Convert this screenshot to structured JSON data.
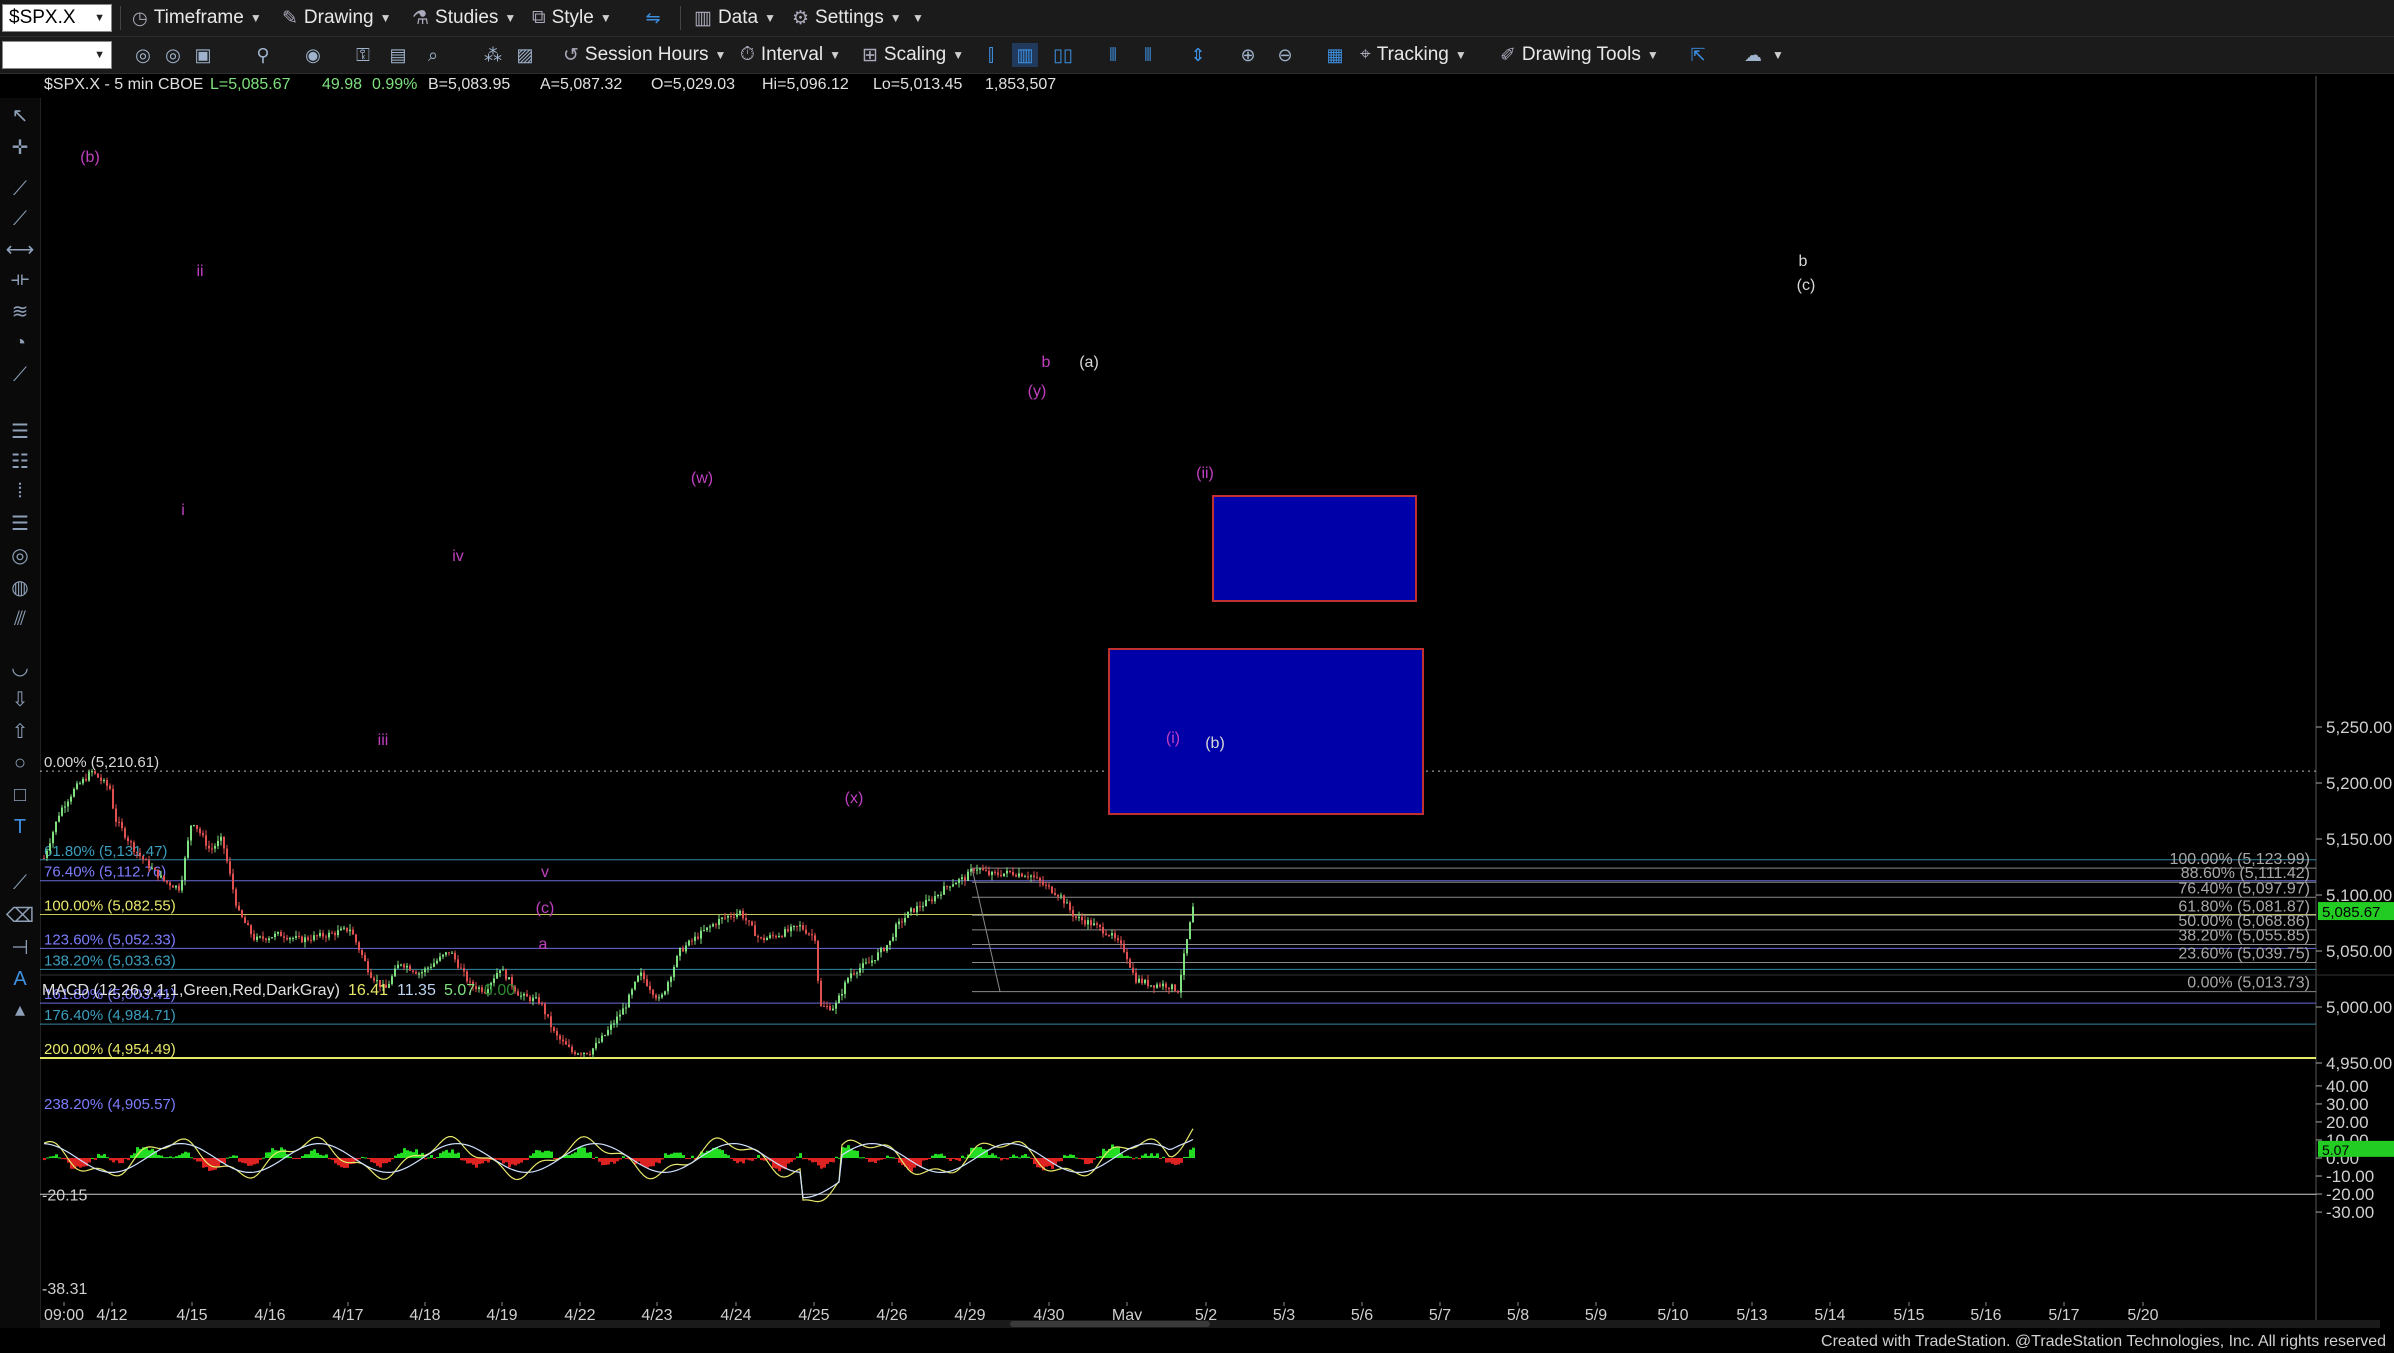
{
  "toolbar1": {
    "symbol": "$SPX.X",
    "timeframe": "Timeframe",
    "drawing": "Drawing",
    "studies": "Studies",
    "style": "Style",
    "data": "Data",
    "settings": "Settings"
  },
  "toolbar2": {
    "session_hours": "Session Hours",
    "interval": "Interval",
    "scaling": "Scaling",
    "tracking": "Tracking",
    "drawing_tools": "Drawing Tools"
  },
  "header": {
    "symbol": "$SPX.X - 5 min",
    "exchange": "CBOE",
    "last": "L=5,085.67",
    "change": "49.98",
    "change_pct": "0.99%",
    "bid": "B=5,083.95",
    "ask": "A=5,087.32",
    "open": "O=5,029.03",
    "high": "Hi=5,096.12",
    "low": "Lo=5,013.45",
    "volume": "1,853,507"
  },
  "price_axis": [
    "5,250.00",
    "5,200.00",
    "5,150.00",
    "5,100.00",
    "5,050.00",
    "5,000.00",
    "4,950.00"
  ],
  "current_price": "5,085.67",
  "fib_left": [
    {
      "label": "0.00% (5,210.61)",
      "color": "#d8d8d8"
    },
    {
      "label": "61.80% (5,131.47)",
      "color": "#3c9fbf"
    },
    {
      "label": "76.40% (5,112.76)",
      "color": "#7d7dff"
    },
    {
      "label": "100.00% (5,082.55)",
      "color": "#e8e86a"
    },
    {
      "label": "123.60% (5,052.33)",
      "color": "#7d7dff"
    },
    {
      "label": "138.20% (5,033.63)",
      "color": "#3c9fbf"
    },
    {
      "label": "161.80% (5,003.41)",
      "color": "#7d7dff"
    },
    {
      "label": "176.40% (4,984.71)",
      "color": "#3c9fbf"
    },
    {
      "label": "200.00% (4,954.49)",
      "color": "#e8e86a"
    },
    {
      "label": "238.20% (4,905.57)",
      "color": "#7d7dff"
    }
  ],
  "fib_right": [
    {
      "label": "100.00% (5,123.99)"
    },
    {
      "label": "88.60% (5,111.42)"
    },
    {
      "label": "76.40% (5,097.97)"
    },
    {
      "label": "61.80% (5,081.87)"
    },
    {
      "label": "50.00% (5,068.86)"
    },
    {
      "label": "38.20% (5,055.85)"
    },
    {
      "label": "23.60% (5,039.75)"
    },
    {
      "label": "0.00% (5,013.73)"
    }
  ],
  "wave_labels": [
    {
      "text": "(b)",
      "color": "#c040c0"
    },
    {
      "text": "ii",
      "color": "#c040c0"
    },
    {
      "text": "i",
      "color": "#c040c0"
    },
    {
      "text": "iv",
      "color": "#c040c0"
    },
    {
      "text": "iii",
      "color": "#c040c0"
    },
    {
      "text": "v",
      "color": "#c040c0"
    },
    {
      "text": "(c)",
      "color": "#c040c0"
    },
    {
      "text": "a",
      "color": "#c040c0"
    },
    {
      "text": "(w)",
      "color": "#c040c0"
    },
    {
      "text": "(x)",
      "color": "#c040c0"
    },
    {
      "text": "(y)",
      "color": "#c040c0"
    },
    {
      "text": "b",
      "color": "#c040c0"
    },
    {
      "text": "(a)",
      "color": "#d8d8d8"
    },
    {
      "text": "(ii)",
      "color": "#c040c0"
    },
    {
      "text": "(i)",
      "color": "#c040c0"
    },
    {
      "text": "(b)",
      "color": "#d8d8d8"
    },
    {
      "text": "b",
      "color": "#d8d8d8"
    },
    {
      "text": "(c)",
      "color": "#d8d8d8"
    }
  ],
  "macd": {
    "title": "MACD (12,26,9,1,1,Green,Red,DarkGray)",
    "v1": "16.41",
    "v2": "11.35",
    "v3": "5.07",
    "v4": "0.00",
    "axis": [
      "40.00",
      "30.00",
      "20.00",
      "10.00",
      "0.00",
      "-10.00",
      "-20.00",
      "-30.00"
    ],
    "current": "5.07",
    "low_label": "-20.15",
    "min_label": "-38.31"
  },
  "time_axis": [
    "09:00",
    "4/12",
    "4/15",
    "4/16",
    "4/17",
    "4/18",
    "4/19",
    "4/22",
    "4/23",
    "4/24",
    "4/25",
    "4/26",
    "4/29",
    "4/30",
    "May",
    "5/2",
    "5/3",
    "5/6",
    "5/7",
    "5/8",
    "5/9",
    "5/10",
    "5/13",
    "5/14",
    "5/15",
    "5/16",
    "5/17",
    "5/20"
  ],
  "credit": "Created with TradeStation. @TradeStation Technologies, Inc. All rights reserved",
  "colors": {
    "up_candle": "#7fe07f",
    "down_candle": "#e05050",
    "box_fill": "#0000a8",
    "box_border": "#c03030",
    "price_badge": "#22cc22"
  }
}
